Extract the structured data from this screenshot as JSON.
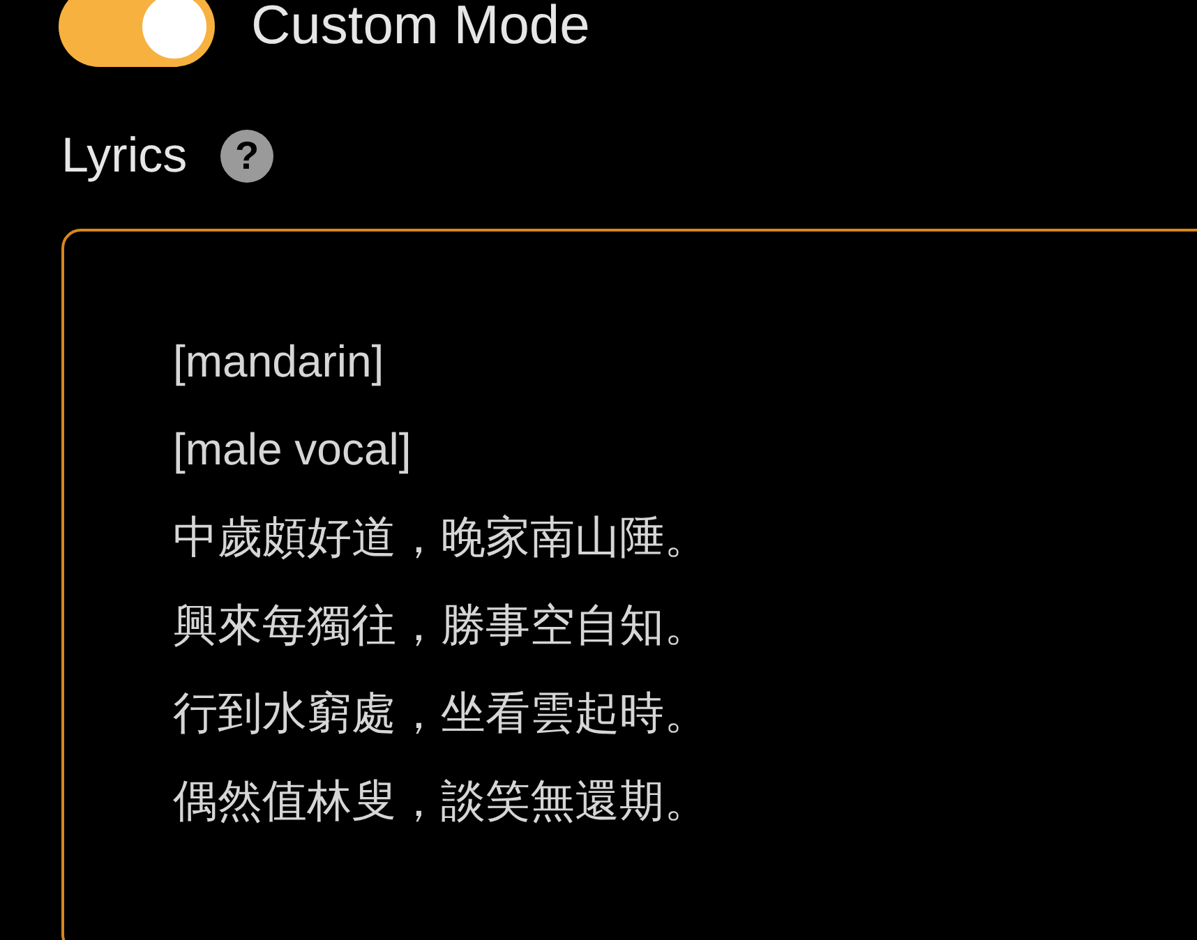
{
  "custom_mode": {
    "label": "Custom Mode",
    "on": true
  },
  "lyrics": {
    "label": "Lyrics",
    "help": "?",
    "lines": [
      "[mandarin]",
      "[male vocal]",
      "中歲頗好道，晚家南山陲。",
      "興來每獨往，勝事空自知。",
      "行到水窮處，坐看雲起時。",
      "偶然值林叟，談笑無還期。"
    ]
  }
}
